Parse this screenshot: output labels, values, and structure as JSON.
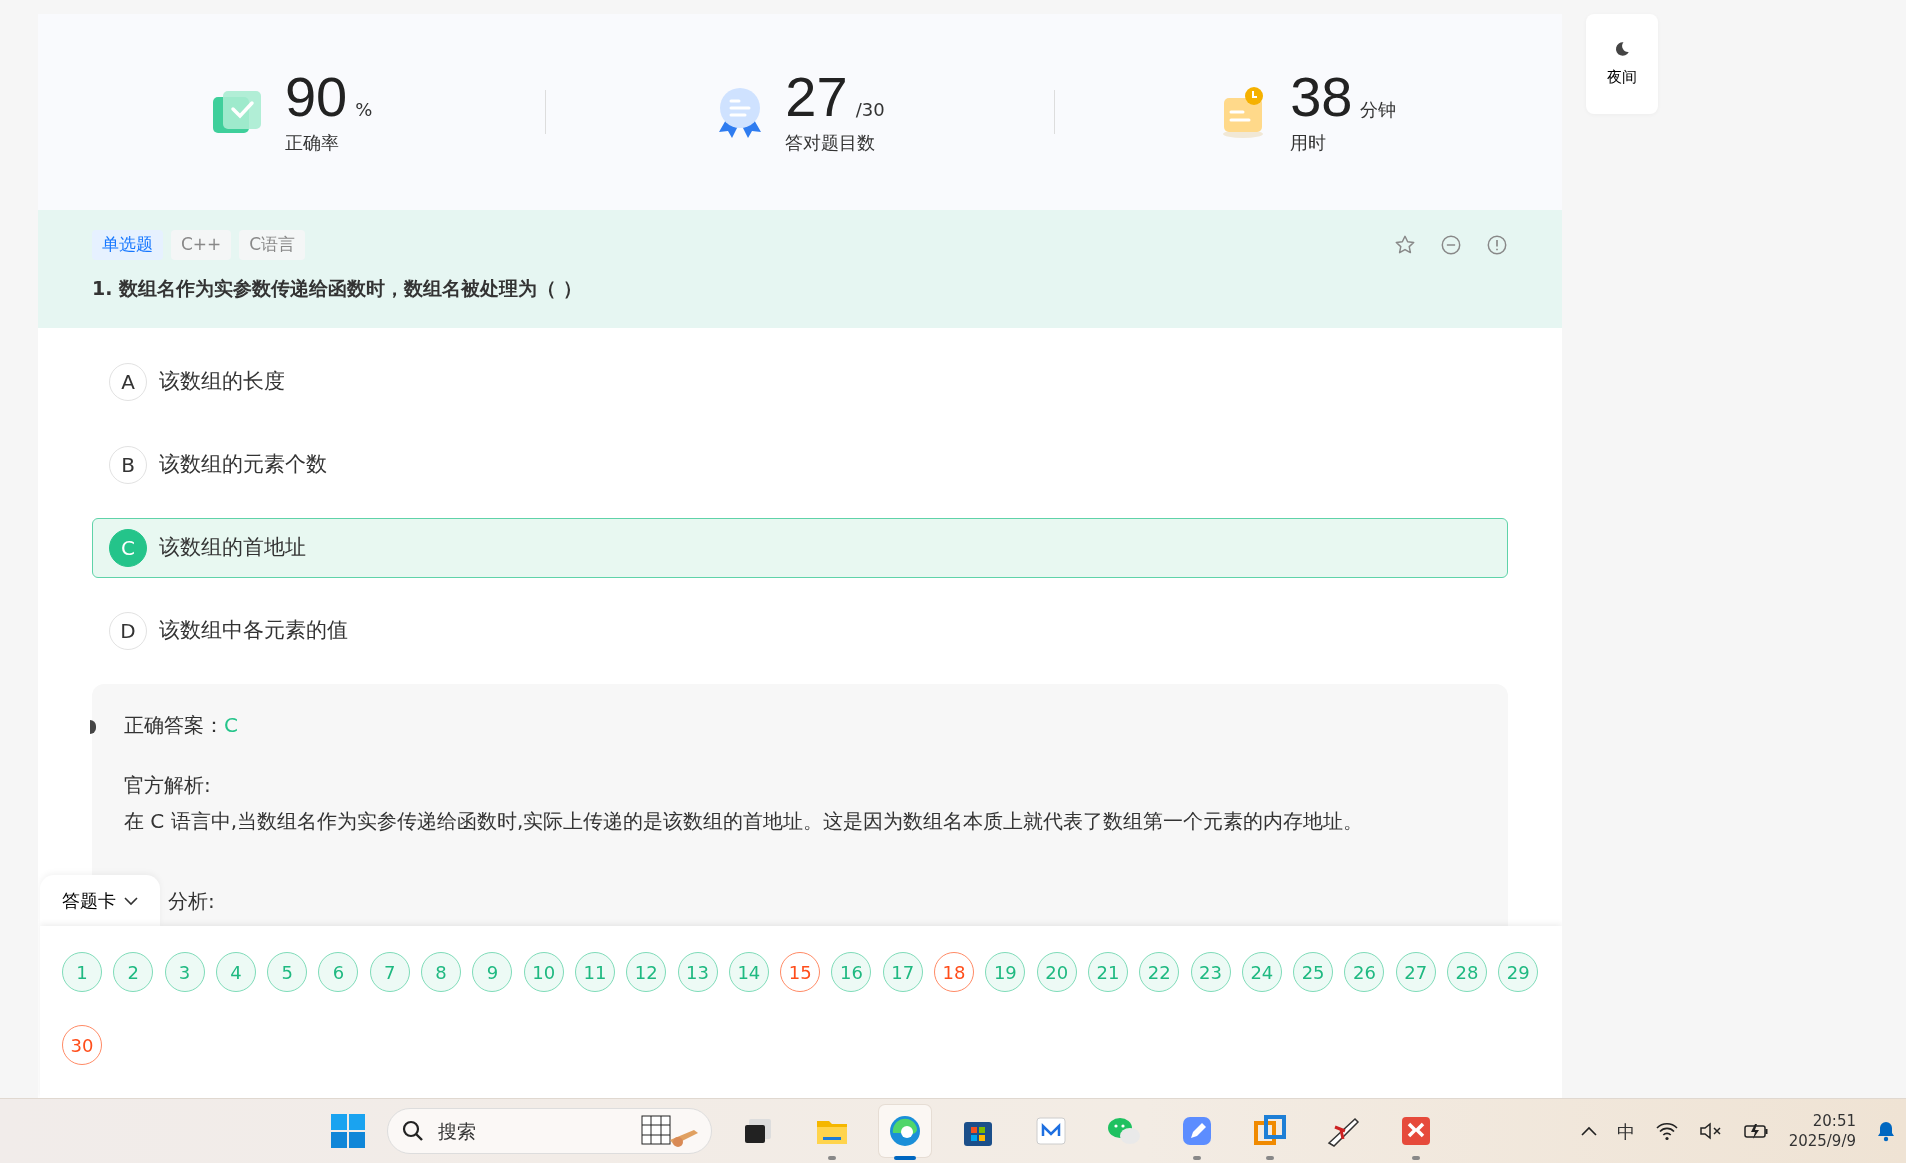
{
  "stats": [
    {
      "kind": "accuracy",
      "value": "90",
      "unit": "%",
      "label": "正确率"
    },
    {
      "kind": "correct",
      "value": "27",
      "unit": "/30",
      "label": "答对题目数"
    },
    {
      "kind": "time",
      "value": "38",
      "unit": "分钟",
      "label": "用时"
    }
  ],
  "night_button": {
    "label": "夜间"
  },
  "question": {
    "tags": [
      {
        "label": "单选题",
        "kind": "type"
      },
      {
        "label": "C++",
        "kind": "topic"
      },
      {
        "label": "C语言",
        "kind": "topic"
      }
    ],
    "title": "1. 数组名作为实参数传递给函数时，数组名被处理为（ ）",
    "options": [
      {
        "letter": "A",
        "text": "该数组的长度",
        "selected": false
      },
      {
        "letter": "B",
        "text": "该数组的元素个数",
        "selected": false
      },
      {
        "letter": "C",
        "text": "该数组的首地址",
        "selected": true
      },
      {
        "letter": "D",
        "text": "该数组中各元素的值",
        "selected": false
      }
    ]
  },
  "analysis": {
    "answer_label": "正确答案：",
    "answer": "C",
    "official_label": "官方解析:",
    "official_text": "在 C 语言中,当数组名作为实参传递给函数时,实际上传递的是该数组的首地址。这是因为数组名本质上就代表了数组第一个元素的内存地址。",
    "more_label": "分析:"
  },
  "answer_card": {
    "title": "答题卡",
    "items": [
      {
        "number": "1",
        "correct": true
      },
      {
        "number": "2",
        "correct": true
      },
      {
        "number": "3",
        "correct": true
      },
      {
        "number": "4",
        "correct": true
      },
      {
        "number": "5",
        "correct": true
      },
      {
        "number": "6",
        "correct": true
      },
      {
        "number": "7",
        "correct": true
      },
      {
        "number": "8",
        "correct": true
      },
      {
        "number": "9",
        "correct": true
      },
      {
        "number": "10",
        "correct": true
      },
      {
        "number": "11",
        "correct": true
      },
      {
        "number": "12",
        "correct": true
      },
      {
        "number": "13",
        "correct": true
      },
      {
        "number": "14",
        "correct": true
      },
      {
        "number": "15",
        "correct": false
      },
      {
        "number": "16",
        "correct": true
      },
      {
        "number": "17",
        "correct": true
      },
      {
        "number": "18",
        "correct": false
      },
      {
        "number": "19",
        "correct": true
      },
      {
        "number": "20",
        "correct": true
      },
      {
        "number": "21",
        "correct": true
      },
      {
        "number": "22",
        "correct": true
      },
      {
        "number": "23",
        "correct": true
      },
      {
        "number": "24",
        "correct": true
      },
      {
        "number": "25",
        "correct": true
      },
      {
        "number": "26",
        "correct": true
      },
      {
        "number": "27",
        "correct": true
      },
      {
        "number": "28",
        "correct": true
      },
      {
        "number": "29",
        "correct": true
      },
      {
        "number": "30",
        "correct": false
      }
    ]
  },
  "taskbar": {
    "search_placeholder": "搜索",
    "apps": [
      {
        "kind": "taskview",
        "running": false,
        "selected": false
      },
      {
        "kind": "folder",
        "running": true,
        "selected": false
      },
      {
        "kind": "browser",
        "running": true,
        "selected": true
      },
      {
        "kind": "store",
        "running": false,
        "selected": false
      },
      {
        "kind": "remote",
        "running": false,
        "selected": false
      },
      {
        "kind": "chat",
        "running": false,
        "selected": false
      },
      {
        "kind": "pen",
        "running": true,
        "selected": false
      },
      {
        "kind": "windows",
        "running": true,
        "selected": false
      },
      {
        "kind": "plane",
        "running": false,
        "selected": false
      },
      {
        "kind": "redapp",
        "running": true,
        "selected": false
      }
    ],
    "ime": "中",
    "time": "20:51",
    "date": "2025/9/9"
  }
}
